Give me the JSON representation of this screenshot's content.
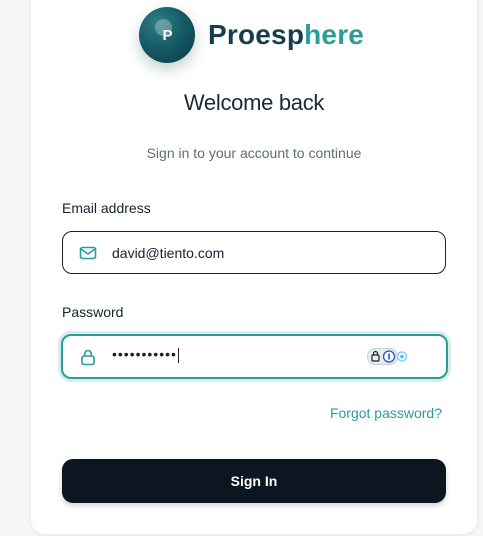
{
  "brand": {
    "logo_letter": "P",
    "name_part1": "Proesp",
    "name_part2": "here",
    "colors": {
      "dark": "#173e4f",
      "accent": "#2a9d9a"
    }
  },
  "heading": {
    "title": "Welcome back",
    "subtitle": "Sign in to your account to continue"
  },
  "form": {
    "email": {
      "label": "Email address",
      "value": "david@tiento.com",
      "icon": "mail-icon"
    },
    "password": {
      "label": "Password",
      "masked_value": "•••••••••••",
      "icon": "lock-icon",
      "focused": true
    },
    "forgot_password_label": "Forgot password?",
    "submit_label": "Sign In"
  }
}
